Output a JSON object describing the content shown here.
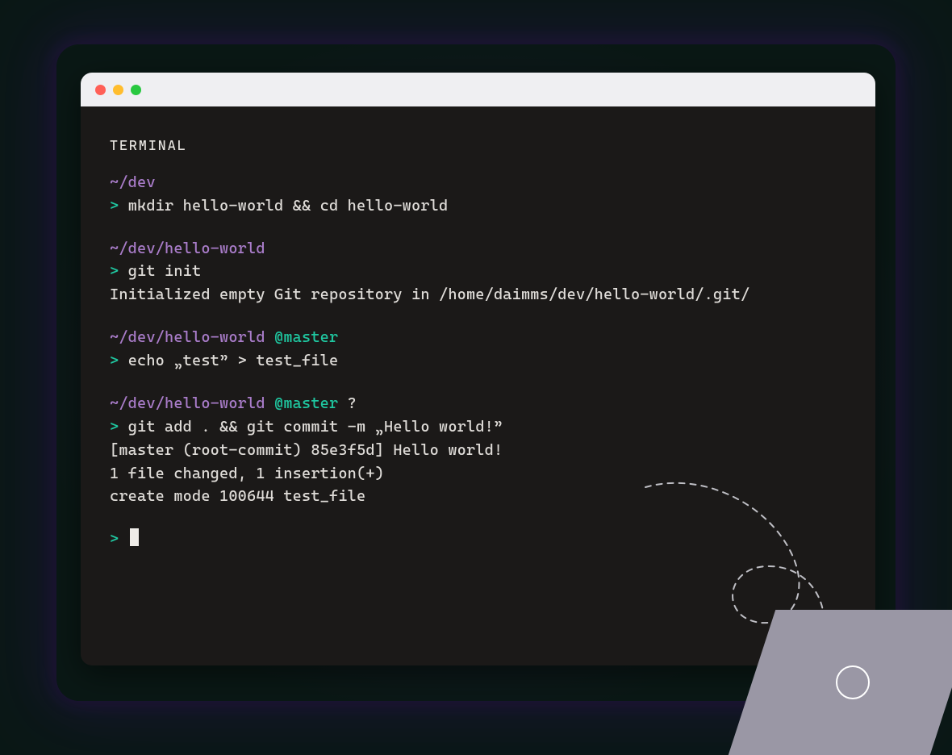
{
  "colors": {
    "traffic_red": "#ff5f57",
    "traffic_yellow": "#ffbd2e",
    "traffic_green": "#28c840",
    "path": "#a97cc9",
    "branch": "#1fc7a0",
    "prompt": "#1fc7a0",
    "terminal_bg": "#1b1918",
    "text": "#dfdcd8"
  },
  "terminal": {
    "label": "TERMINAL",
    "blocks": [
      {
        "path": "~/dev",
        "branch": "",
        "status": "",
        "prompt": ">",
        "command": "mkdir hello-world && cd hello-world",
        "output": []
      },
      {
        "path": "~/dev/hello-world",
        "branch": "",
        "status": "",
        "prompt": ">",
        "command": "git init",
        "output": [
          "Initialized empty Git repository in /home/daimms/dev/hello-world/.git/"
        ]
      },
      {
        "path": "~/dev/hello-world",
        "branch": "@master",
        "status": "",
        "prompt": ">",
        "command": "echo „test” > test_file",
        "output": []
      },
      {
        "path": "~/dev/hello-world",
        "branch": "@master",
        "status": "?",
        "prompt": ">",
        "command": "git add . && git commit -m „Hello world!”",
        "output": [
          "[master (root-commit) 85e3f5d] Hello world!",
          "1 file changed, 1 insertion(+)",
          "create mode 100644 test_file"
        ]
      }
    ],
    "final_prompt": ">"
  }
}
